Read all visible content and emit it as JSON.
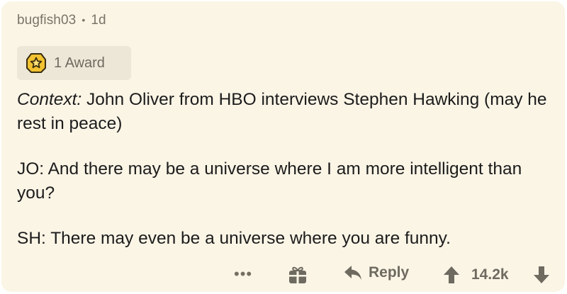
{
  "comment": {
    "username": "bugfish03",
    "separator": "•",
    "age": "1d",
    "award_label": "1 Award",
    "paragraphs": {
      "p1_label": "Context:",
      "p1_text": " John Oliver from HBO interviews Stephen Hawking (may he rest in peace)",
      "p2_text": "JO: And there may be a universe where I am more intelligent than you?",
      "p3_text": "SH: There may even be a universe where you are funny."
    }
  },
  "actions": {
    "more": "•••",
    "reply_label": "Reply",
    "score": "14.2k"
  },
  "icons": {
    "award": "award-star-icon",
    "gift": "gift-icon",
    "reply": "reply-arrow-icon",
    "upvote": "upvote-arrow-icon",
    "downvote": "downvote-arrow-icon"
  },
  "colors": {
    "card_background": "#fbf5e6",
    "pill_background": "#ede7d8",
    "muted_text": "#6e6a5f",
    "body_text": "#1c1c1c",
    "award_gold": "#f2c230"
  }
}
